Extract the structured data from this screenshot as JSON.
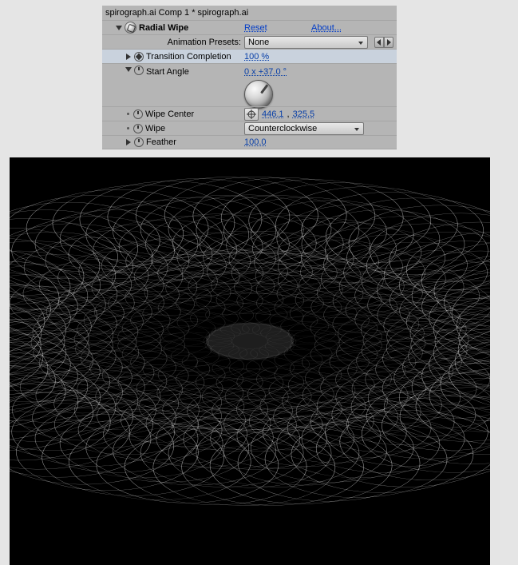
{
  "title": "spirograph.ai Comp 1 * spirograph.ai",
  "effect": {
    "name": "Radial Wipe",
    "reset_label": "Reset",
    "about_label": "About...",
    "presets_label": "Animation Presets:",
    "presets_value": "None"
  },
  "props": {
    "transition_completion": {
      "label": "Transition Completion",
      "value": "100 %"
    },
    "start_angle": {
      "label": "Start Angle",
      "value": "0 x +37.0 °"
    },
    "wipe_center": {
      "label": "Wipe Center",
      "value_x": "446.1",
      "value_y": "325.5"
    },
    "wipe": {
      "label": "Wipe",
      "value": "Counterclockwise"
    },
    "feather": {
      "label": "Feather",
      "value": "100.0"
    }
  },
  "icons": {
    "triangle_right": "▶",
    "triangle_down": "▼"
  }
}
